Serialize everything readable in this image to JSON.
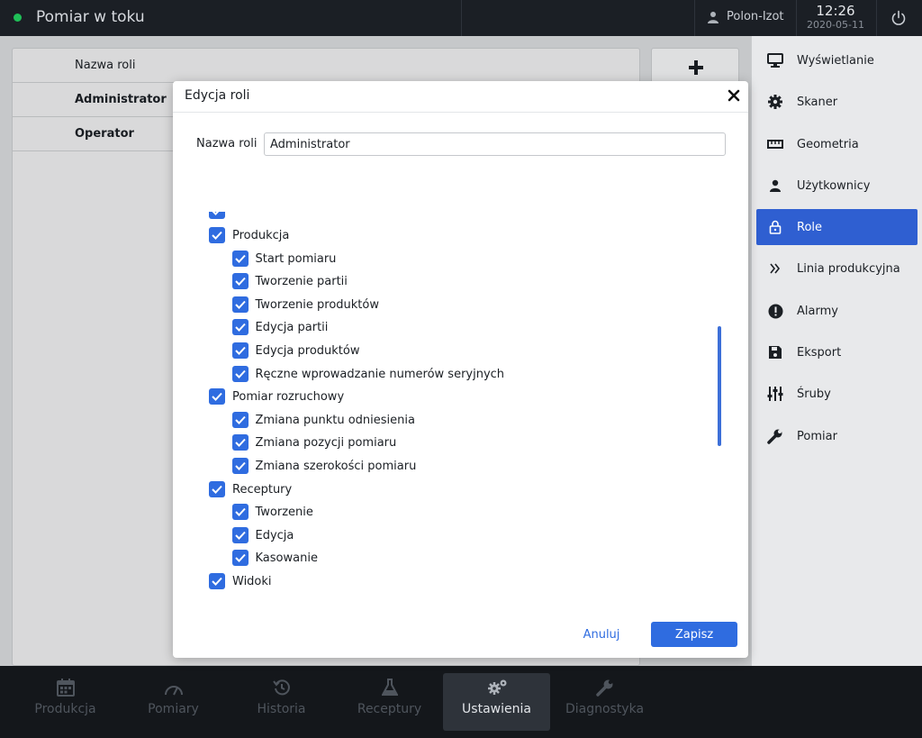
{
  "topbar": {
    "status_text": "Pomiar w toku",
    "status_color": "#1fbf57",
    "user": "Polon-Izot",
    "time": "12:26",
    "date": "2020-05-11"
  },
  "roles_table": {
    "header": "Nazwa roli",
    "rows": [
      "Administrator",
      "Operator"
    ]
  },
  "sidebar": {
    "items": [
      {
        "label": "Wyświetlanie",
        "icon": "monitor-icon"
      },
      {
        "label": "Skaner",
        "icon": "gear-icon"
      },
      {
        "label": "Geometria",
        "icon": "ruler-icon"
      },
      {
        "label": "Użytkownicy",
        "icon": "user-icon"
      },
      {
        "label": "Role",
        "icon": "lock-icon"
      },
      {
        "label": "Linia produkcyjna",
        "icon": "double-chevron-icon"
      },
      {
        "label": "Alarmy",
        "icon": "alert-icon"
      },
      {
        "label": "Eksport",
        "icon": "save-icon"
      },
      {
        "label": "Śruby",
        "icon": "sliders-icon"
      },
      {
        "label": "Pomiar",
        "icon": "wrench-icon"
      }
    ],
    "active": "Role"
  },
  "bottom_nav": {
    "items": [
      {
        "label": "Produkcja",
        "icon": "calendar-icon"
      },
      {
        "label": "Pomiary",
        "icon": "gauge-icon"
      },
      {
        "label": "Historia",
        "icon": "history-icon"
      },
      {
        "label": "Receptury",
        "icon": "flask-icon"
      },
      {
        "label": "Ustawienia",
        "icon": "gears-icon"
      },
      {
        "label": "Diagnostyka",
        "icon": "wrench-icon"
      }
    ],
    "active": "Ustawienia"
  },
  "modal": {
    "title": "Edycja roli",
    "name_label": "Nazwa roli",
    "name_value": "Administrator",
    "permissions": [
      {
        "label": "Produkcja",
        "level": 0,
        "checked": true
      },
      {
        "label": "Start pomiaru",
        "level": 1,
        "checked": true
      },
      {
        "label": "Tworzenie partii",
        "level": 1,
        "checked": true
      },
      {
        "label": "Tworzenie produktów",
        "level": 1,
        "checked": true
      },
      {
        "label": "Edycja partii",
        "level": 1,
        "checked": true
      },
      {
        "label": "Edycja produktów",
        "level": 1,
        "checked": true
      },
      {
        "label": "Ręczne wprowadzanie numerów seryjnych",
        "level": 1,
        "checked": true
      },
      {
        "label": "Pomiar rozruchowy",
        "level": 0,
        "checked": true
      },
      {
        "label": "Zmiana punktu odniesienia",
        "level": 1,
        "checked": true
      },
      {
        "label": "Zmiana pozycji pomiaru",
        "level": 1,
        "checked": true
      },
      {
        "label": "Zmiana szerokości pomiaru",
        "level": 1,
        "checked": true
      },
      {
        "label": "Receptury",
        "level": 0,
        "checked": true
      },
      {
        "label": "Tworzenie",
        "level": 1,
        "checked": true
      },
      {
        "label": "Edycja",
        "level": 1,
        "checked": true
      },
      {
        "label": "Kasowanie",
        "level": 1,
        "checked": true
      },
      {
        "label": "Widoki",
        "level": 0,
        "checked": true
      }
    ],
    "cancel_label": "Anuluj",
    "save_label": "Zapisz"
  }
}
